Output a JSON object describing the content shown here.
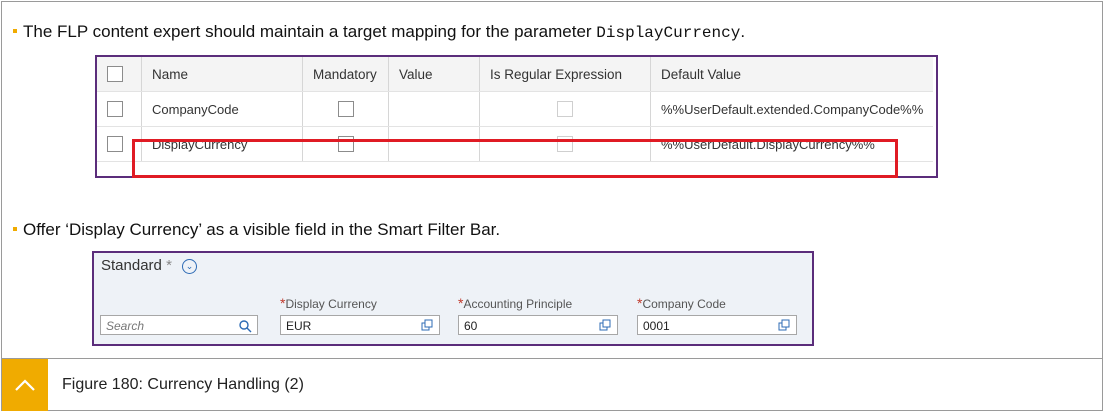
{
  "bullets": {
    "first_text": "The FLP content expert should maintain a target mapping for the parameter ",
    "first_code": "DisplayCurrency",
    "first_end": ".",
    "second": "Offer ‘Display Currency’ as a visible field in the Smart Filter Bar."
  },
  "table": {
    "headers": [
      "Name",
      "Mandatory",
      "Value",
      "Is Regular Expression",
      "Default Value"
    ],
    "rows": [
      {
        "name": "CompanyCode",
        "value": "",
        "default": "%%UserDefault.extended.CompanyCode%%"
      },
      {
        "name": "DisplayCurrency",
        "value": "",
        "default": "%%UserDefault.DisplayCurrency%%"
      }
    ]
  },
  "filter_bar": {
    "variant": "Standard",
    "variant_star": "*",
    "search_placeholder": "Search",
    "fields": [
      {
        "label": "Display Currency",
        "value": "EUR"
      },
      {
        "label": "Accounting Principle",
        "value": "60"
      },
      {
        "label": "Company Code",
        "value": "0001"
      }
    ]
  },
  "caption": "Figure 180: Currency Handling (2)",
  "colors": {
    "accent": "#f0ab00",
    "frame": "#5b2d7b",
    "highlight": "#e01b24"
  }
}
